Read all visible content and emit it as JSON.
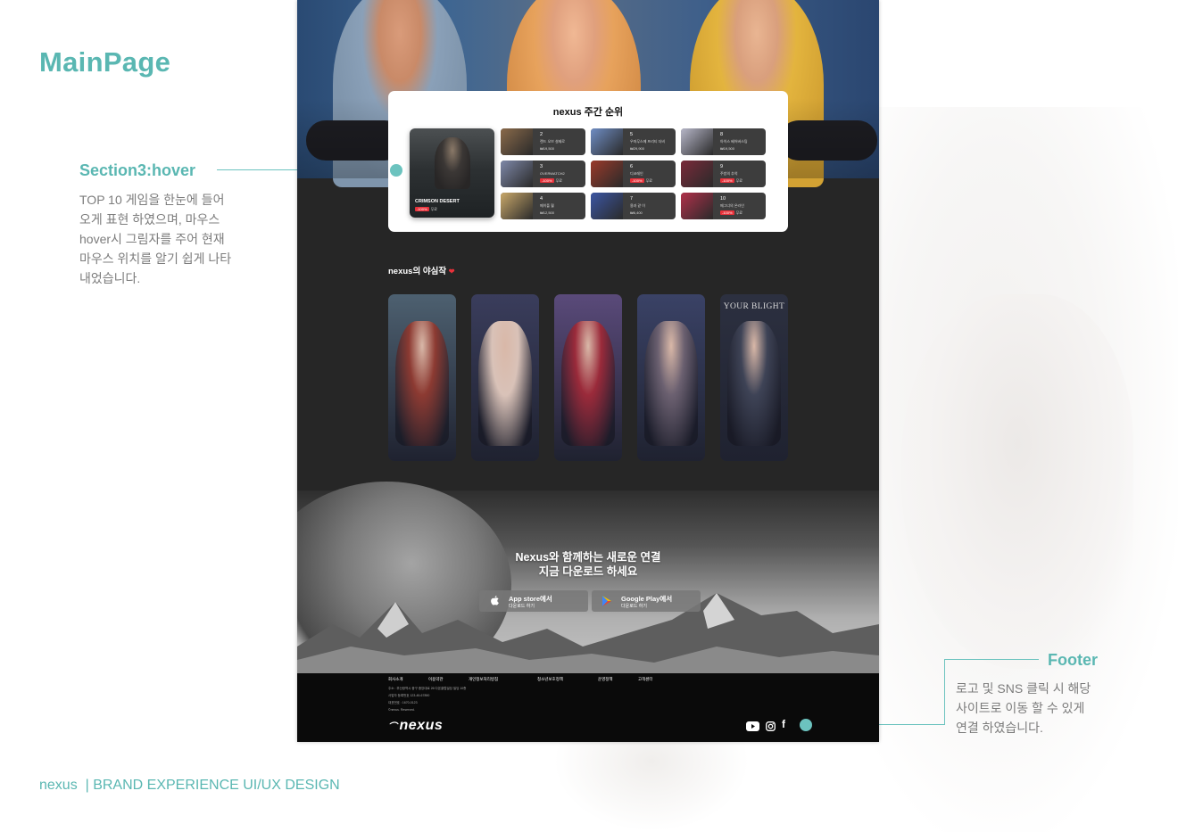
{
  "page": {
    "heading": "MainPage",
    "brand_name": "nexus",
    "brand_tagline": "| BRAND EXPERIENCE UI/UX DESIGN"
  },
  "annotations": {
    "section3": {
      "title": "Section3:hover",
      "lines": [
        "TOP 10 게임을 한눈에 들어",
        "오게 표현 하였으며, 마우스",
        "hover시 그림자를 주어 현재",
        "마우스 위치를 알기 쉽게 나타",
        "내었습니다."
      ]
    },
    "footer": {
      "title": "Footer",
      "lines": [
        "로고 및 SNS 클릭 시 해당",
        "사이트로 이동 할 수 있게",
        "연결 하였습니다."
      ]
    }
  },
  "accent_color": "#5ab7b2",
  "site": {
    "ranking": {
      "title": "nexus 주간 순위",
      "featured": {
        "name": "CRIMSON DESERT",
        "discount": "-100%",
        "price": "무료"
      },
      "items": [
        {
          "rank": "2",
          "name": "랜드 오브 설제로",
          "discount": "",
          "price": "₩19,500",
          "color": "#8a6a4a"
        },
        {
          "rank": "3",
          "name": "OVERWATCH2",
          "discount": "-100%",
          "price": "무료",
          "color": "#7e88a8"
        },
        {
          "rank": "4",
          "name": "메이플 월",
          "discount": "",
          "price": "₩12,500",
          "color": "#c9a86a"
        },
        {
          "rank": "5",
          "name": "우마무스메 프리티 더비",
          "discount": "",
          "price": "₩29,900",
          "color": "#6f8dc4"
        },
        {
          "rank": "6",
          "name": "디코레인",
          "discount": "-100%",
          "price": "무료",
          "color": "#9a3a2a"
        },
        {
          "rank": "7",
          "name": "용과 같 이",
          "discount": "",
          "price": "₩6,400",
          "color": "#3c56a3"
        },
        {
          "rank": "8",
          "name": "아이스 베어버스팅",
          "discount": "",
          "price": "₩19,500",
          "color": "#b7b7c9"
        },
        {
          "rank": "9",
          "name": "주방의 추억",
          "discount": "-100%",
          "price": "무료",
          "color": "#7a2a3a"
        },
        {
          "rank": "10",
          "name": "메그너의 온라인",
          "discount": "-100%",
          "price": "무료",
          "color": "#b0304a"
        }
      ]
    },
    "picks": {
      "title": "nexus의 야심작",
      "heart": "❤",
      "cards": [
        {
          "title": "",
          "color1": "#4d6070",
          "color2": "#8c3a32"
        },
        {
          "title": "",
          "color1": "#3a3d5c",
          "color2": "#d9c2b8"
        },
        {
          "title": "",
          "color1": "#5a4a7a",
          "color2": "#9a2a3a"
        },
        {
          "title": "",
          "color1": "#3a4266",
          "color2": "#6b6070"
        },
        {
          "title": "YOUR BLIGHT",
          "color1": "#2c3040",
          "color2": "#3e4356"
        }
      ]
    },
    "promo": {
      "line1": "Nexus와 함께하는 새로운 연결",
      "line2": "지금 다운로드 하세요",
      "app_store": {
        "main": "App store에서",
        "sub": "다운로드 하기"
      },
      "google_play": {
        "main": "Google Play에서",
        "sub": "다운로드 하기"
      }
    },
    "footer": {
      "links": [
        "회사소개",
        "이용약관",
        "개인정보처리방침",
        "청소년보호정책",
        "운영정책",
        "고객센터"
      ],
      "info": [
        "주소 : 부산광역시 중구 중앙대로 26 다온클럽빌딩 빌딩 10층",
        "사업자 등록번호 123-45-67890",
        "대표번호 : 1670-0123",
        "©nexus. Reserved."
      ],
      "logo": "nexus",
      "sns": [
        "youtube-icon",
        "instagram-icon",
        "facebook-icon"
      ]
    }
  }
}
